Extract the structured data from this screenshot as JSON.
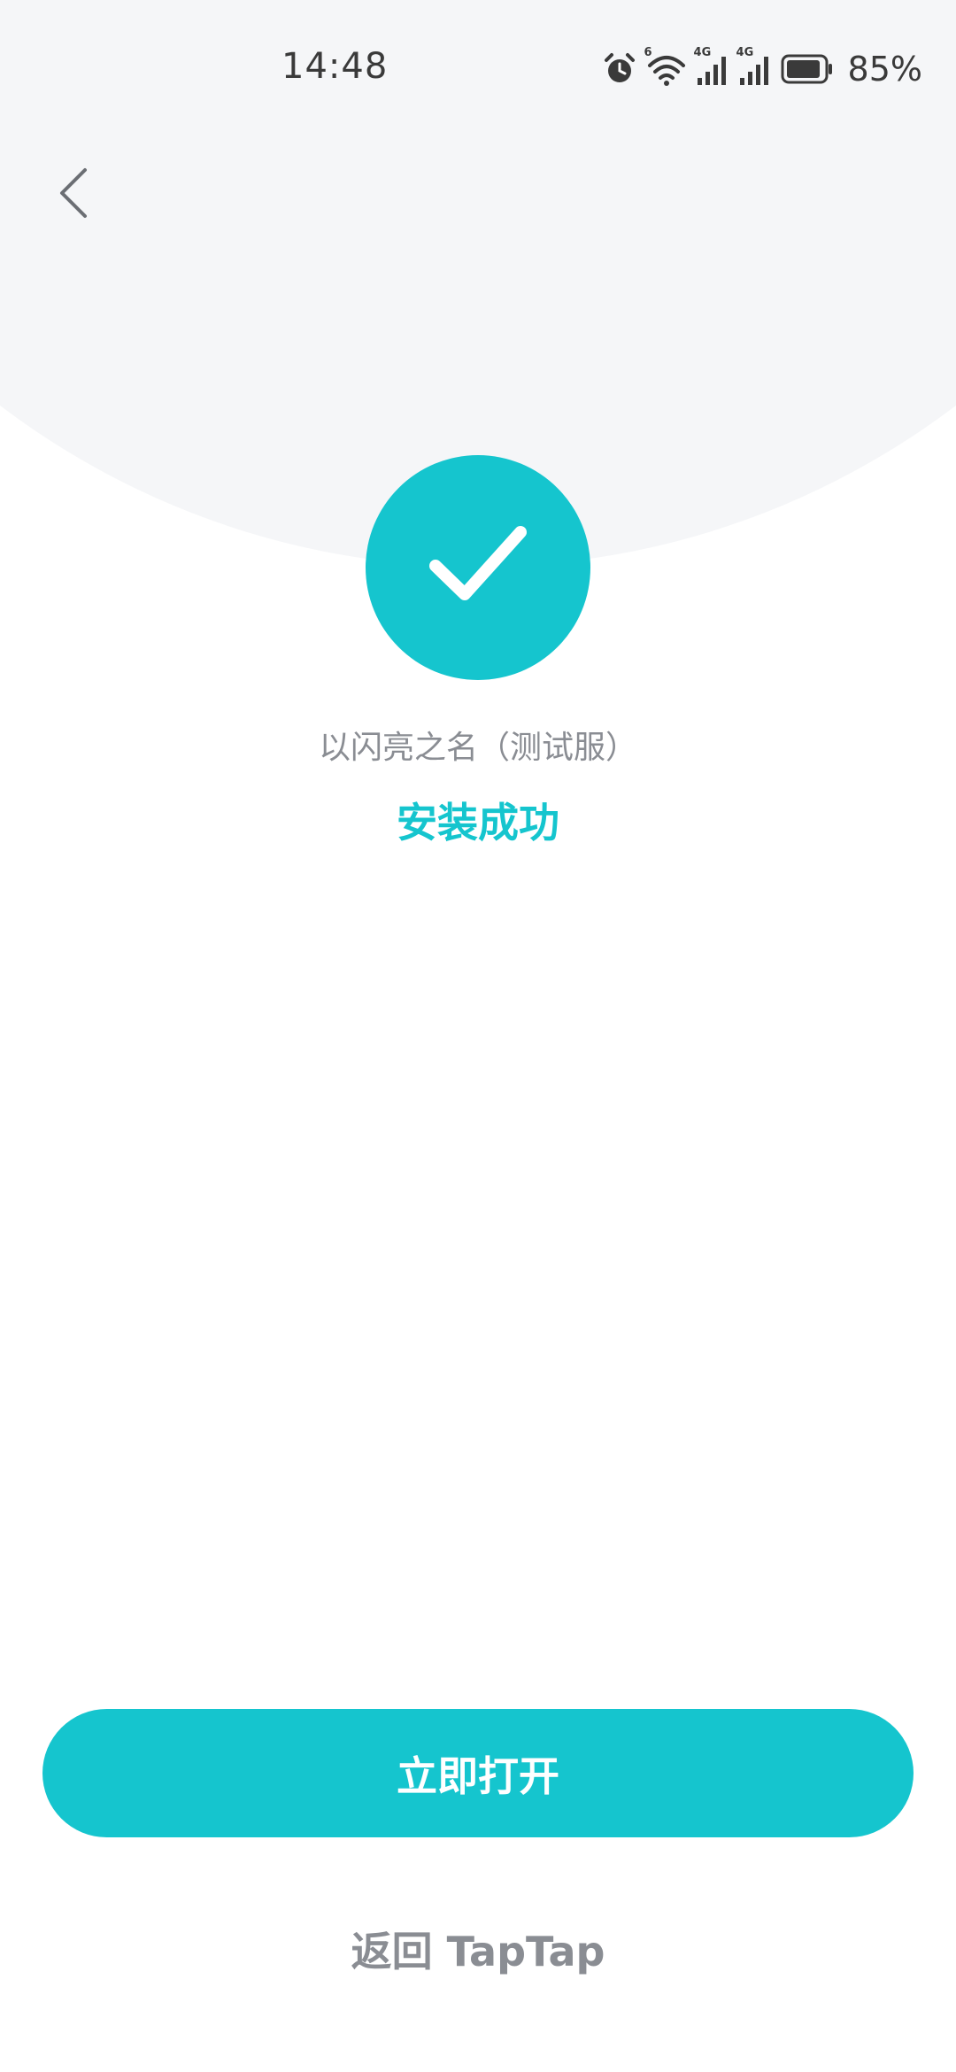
{
  "status_bar": {
    "time": "14:48",
    "battery_percent": "85%",
    "wifi_badge": "6",
    "network_label_1": "4G",
    "network_label_2": "4G",
    "icons": [
      "alarm-icon",
      "wifi-icon",
      "signal-icon",
      "signal-icon",
      "battery-icon"
    ]
  },
  "header": {
    "back_icon": "chevron-left-icon"
  },
  "result": {
    "icon": "checkmark-icon",
    "app_name": "以闪亮之名（测试服）",
    "status_text": "安装成功"
  },
  "actions": {
    "open_label": "立即打开",
    "return_label": "返回 TapTap"
  },
  "colors": {
    "accent": "#15c5ce",
    "secondary_text": "#8a8d93",
    "top_background": "#f5f6f8"
  }
}
